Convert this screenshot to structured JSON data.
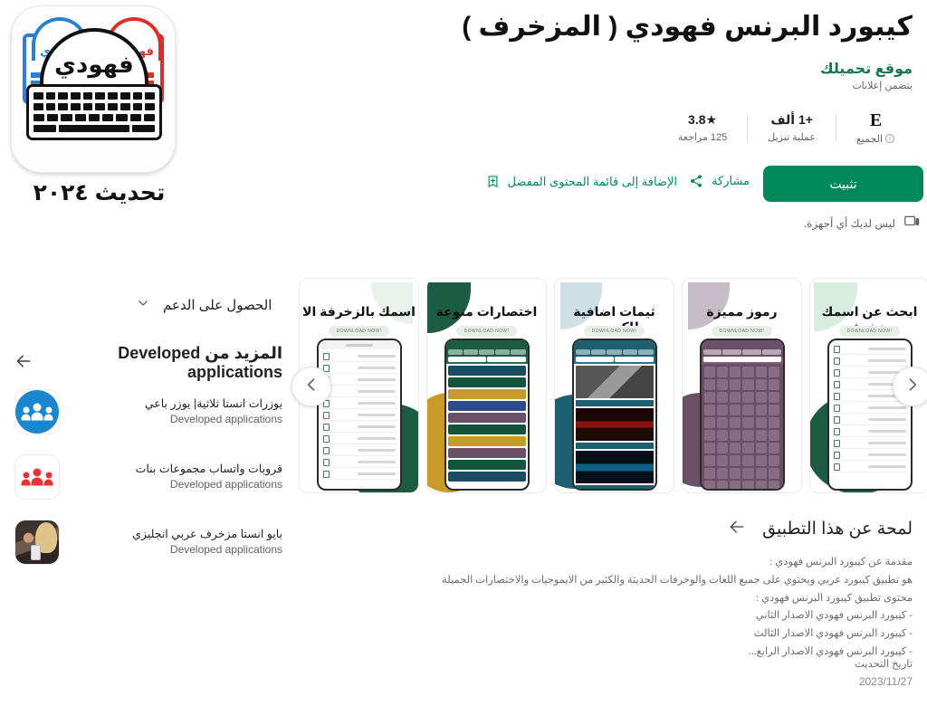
{
  "app": {
    "title": "كيبورد البرنس فهودي ( المزخرف )",
    "developer": "موقع تحميلك",
    "ads_note": "يتضمن إعلانات",
    "icon": {
      "dome_text": "فهودي",
      "badge_blue": "فهودي",
      "badge_red": "فهودي",
      "caption": "تحديث ٢٠٢٤"
    }
  },
  "stats": {
    "rating": {
      "value": "★3.8",
      "label": "125 مراجعة"
    },
    "downloads": {
      "value": "+1 ألف",
      "label": "عملية تنزيل"
    },
    "content_rating": {
      "value": "E",
      "label": "الجميع"
    }
  },
  "actions": {
    "install_label": "تثبيت",
    "share_label": "مشاركة",
    "wishlist_label": "الإضافة إلى قائمة المحتوى المفضل",
    "no_devices": "ليس لديك أي أجهزة."
  },
  "screenshots": [
    {
      "headline": "اسمك بالزخرفة الا",
      "cta": "DOWNLOAD NOW!",
      "accent": "#1d5c44",
      "blob": "#e8f1ec",
      "kind": "copy-list"
    },
    {
      "headline": "اختصارات منوعة",
      "cta": "DOWNLOAD NOW!",
      "accent": "#1d5c44",
      "blob": "#c79a29",
      "kind": "rows"
    },
    {
      "headline": "ثيمات اضافية للكيبورد",
      "cta": "DOWNLOAD NOW!",
      "accent": "#1c5f70",
      "blob": "#cfdfe6",
      "kind": "themes"
    },
    {
      "headline": "رموز مميزة",
      "cta": "DOWNLOAD NOW!",
      "accent": "#6b4f66",
      "blob": "#c8bcc6",
      "kind": "keys"
    },
    {
      "headline": "ابحث عن اسمك مزخرف",
      "cta": "DOWNLOAD NOW!",
      "accent": "#1d5c44",
      "blob": "#d9ece0",
      "kind": "copy-list"
    }
  ],
  "carousel": {
    "prev_icon": "chevron-left-icon",
    "next_icon": "chevron-right-icon"
  },
  "support": {
    "label": "الحصول على الدعم"
  },
  "more_apps": {
    "heading": "المزيد من Developed applications",
    "items": [
      {
        "name": "يوزرات انستا ثلاثية| يوزر باعي",
        "developer": "Developed applications",
        "icon": "people-blue-icon"
      },
      {
        "name": "قروبات واتساب مجموعات بنات",
        "developer": "Developed applications",
        "icon": "people-red-icon"
      },
      {
        "name": "بايو انستا مزخرف عربي انجليزي",
        "developer": "Developed applications",
        "icon": "couple-photo-icon"
      }
    ]
  },
  "about": {
    "heading": "لمحة عن هذا التطبيق",
    "body": "مقدمة عن كيبورد البرنس فهودي :\nهو تطبيق كيبورد عربي ويحتوي على جميع اللغات والوخرفات الحديثة والكثير من الايموجيات والاختصارات الجميلة\nمحتوى تطبيق كيبورد البرنس فهودي :\n- كيبورد البرنس فهودي الاصدار الثاني\n- كيبورد البرنس فهودي الاصدار الثالث\n- كيبورد البرنس فهودي الاصدار الرابع...",
    "update_label": "تاريخ التحديث",
    "update_date": "2023/11/27"
  },
  "colors": {
    "install_green": "#00875a",
    "developer_green": "#15794b",
    "link_green": "#01875f"
  }
}
